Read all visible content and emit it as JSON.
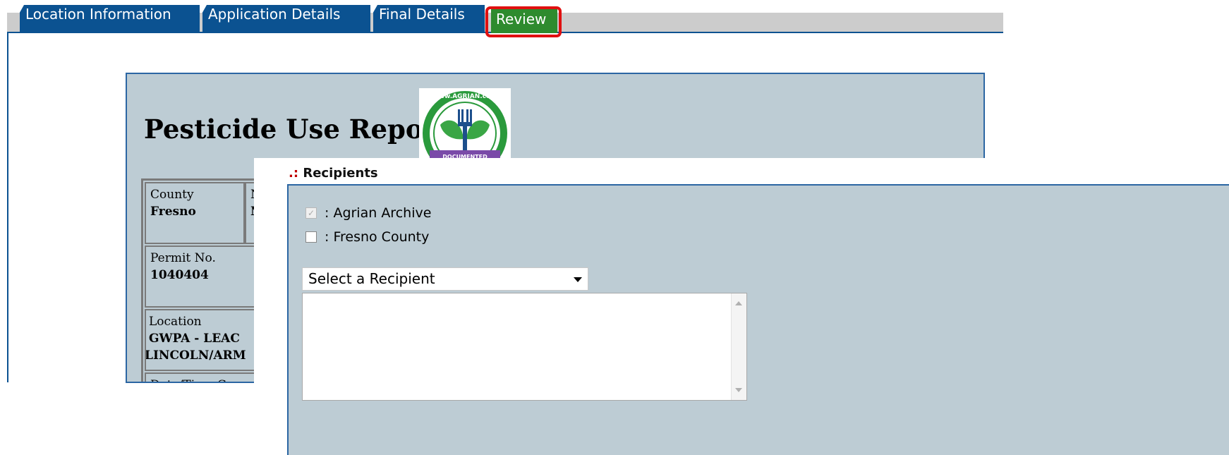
{
  "tabs": [
    {
      "label": "Location Information"
    },
    {
      "label": "Application Details"
    },
    {
      "label": "Final Details"
    },
    {
      "label": "Review",
      "active": true
    }
  ],
  "report": {
    "title": "Pesticide Use Report",
    "logo_text": "www.AGRIAN.com",
    "logo_badge": "DOCUMENTED",
    "table": {
      "county_label": "County",
      "county_value": "Fresno",
      "second_label": "N",
      "second_value": "N",
      "permit_label": "Permit No.",
      "permit_value": "1040404",
      "location_label": "Location",
      "location_value_1": "GWPA - LEAC",
      "location_value_2": "LINCOLN/ARM",
      "date_label": "Date/Time Com"
    }
  },
  "recipients": {
    "title_prefix": ".:",
    "title": "Recipients",
    "options": [
      {
        "label": ": Agrian Archive",
        "checked": true,
        "disabled": true
      },
      {
        "label": ": Fresno County",
        "checked": false,
        "disabled": false
      }
    ],
    "select_value": "Select a Recipient",
    "list_items": []
  },
  "colors": {
    "tab_blue": "#0b5291",
    "tab_active_green": "#2e8b2e",
    "highlight_red": "#e01010",
    "panel_bg": "#bdccd4",
    "title_prefix_red": "#c00000"
  }
}
